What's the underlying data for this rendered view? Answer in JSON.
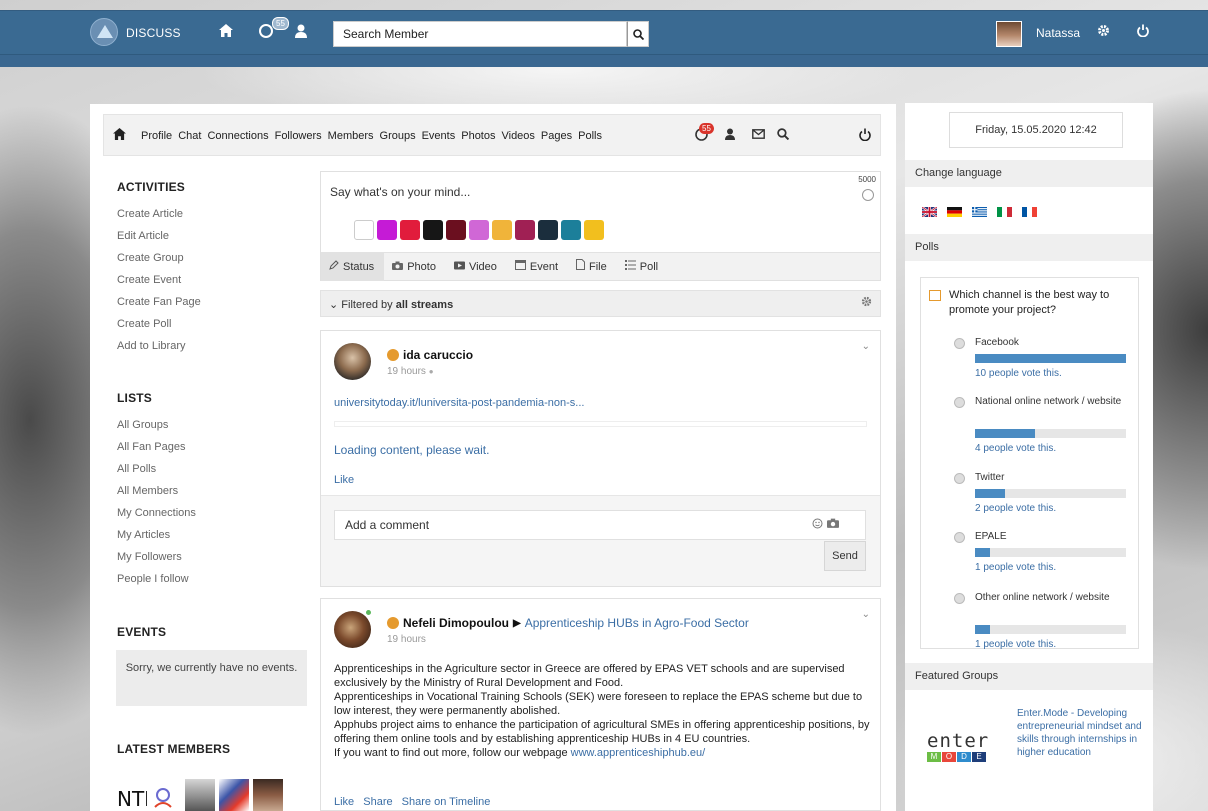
{
  "topbar": {
    "brand": "DISCUSS",
    "notifications_count": "55",
    "search_value": "Search Member",
    "username": "Natassa"
  },
  "nav": {
    "items": [
      "Profile",
      "Chat",
      "Connections",
      "Followers",
      "Members",
      "Groups",
      "Events",
      "Photos",
      "Videos",
      "Pages",
      "Polls"
    ],
    "badge": "55"
  },
  "sidebar": {
    "activities_title": "ACTIVITIES",
    "activities": [
      "Create Article",
      "Edit Article",
      "Create Group",
      "Create Event",
      "Create Fan Page",
      "Create Poll",
      "Add to Library"
    ],
    "lists_title": "LISTS",
    "lists": [
      "All Groups",
      "All Fan Pages",
      "All Polls",
      "All Members",
      "My Connections",
      "My Articles",
      "My Followers",
      "People I follow"
    ],
    "events_title": "EVENTS",
    "events_empty": "Sorry, we currently have no events.",
    "latest_members_title": "LATEST MEMBERS"
  },
  "composer": {
    "placeholder": "Say what's on your mind...",
    "char_count": "5000",
    "tabs": [
      "Status",
      "Photo",
      "Video",
      "Event",
      "File",
      "Poll"
    ],
    "swatch_colors": [
      "#ffffff",
      "#c51bd6",
      "#e11c3c",
      "#161616",
      "#6b0f1f",
      "#d067d6",
      "#f0b43a",
      "#a02054",
      "#1b2e3d",
      "#1c7f9a",
      "#f2bf1e"
    ]
  },
  "filter": {
    "prefix": "Filtered by",
    "value": "all streams"
  },
  "post1": {
    "author": "ida caruccio",
    "time": "19 hours",
    "link": "universitytoday.it/luniversita-post-pandemia-non-s...",
    "loading": "Loading content, please wait.",
    "like": "Like",
    "comment_placeholder": "Add a comment",
    "send": "Send"
  },
  "post2": {
    "author": "Nefeli Dimopoulou",
    "arrow": "▶",
    "target": "Apprenticeship HUBs in Agro-Food Sector",
    "time": "19 hours",
    "paragraphs": [
      "Apprenticeships in the Agriculture sector in Greece are offered by EPAS VET schools and are supervised exclusively by the Ministry of Rural Development and Food.",
      "Apprenticeships in Vocational Training Schools (SEK) were foreseen to replace the EPAS scheme but due to low interest, they were permanently abolished.",
      "Apphubs project aims to enhance the participation of agricultural SMEs in offering apprenticeship positions, by offering them online tools and by establishing apprenticeship HUBs in 4 EU countries."
    ],
    "follow_text": "If you want to find out more, follow our webpage",
    "follow_link": "www.apprenticeshiphub.eu/",
    "actions": [
      "Like",
      "Share",
      "Share on Timeline"
    ]
  },
  "right": {
    "date": "Friday, 15.05.2020 12:42",
    "change_language": "Change language",
    "polls_title": "Polls",
    "poll_question": "Which channel is the best way to promote your project?",
    "poll_options": [
      {
        "label": "Facebook",
        "votes": "10 people vote this.",
        "fraction": 1.0
      },
      {
        "label": "National online network / website",
        "votes": "4 people vote this.",
        "fraction": 0.4
      },
      {
        "label": "Twitter",
        "votes": "2 people vote this.",
        "fraction": 0.2
      },
      {
        "label": "EPALE",
        "votes": "1 people vote this.",
        "fraction": 0.1
      },
      {
        "label": "Other online network / website",
        "votes": "1 people vote this.",
        "fraction": 0.1
      }
    ],
    "featured_title": "Featured Groups",
    "featured_group": "Enter.Mode - Developing entrepreneurial mindset and skills through internships in higher education",
    "featured_logo_top": "enter",
    "featured_logo_letters": [
      "M",
      "O",
      "D",
      "E"
    ]
  },
  "colors": {
    "topbar": "#3a6a92",
    "link": "#3b6ea5",
    "bar": "#4a8bc2",
    "badge": "#d9342b"
  }
}
